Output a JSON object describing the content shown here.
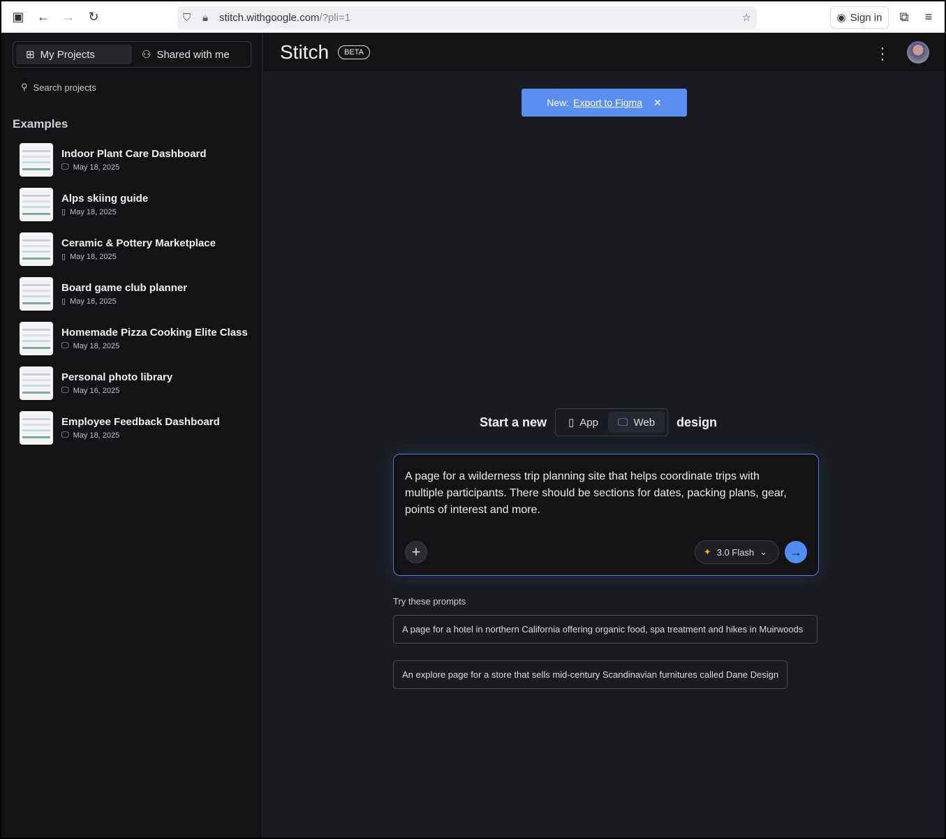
{
  "browser": {
    "url_host": "stitch.withgoogle.com",
    "url_query": "/?pli=1",
    "sign_in": "Sign in"
  },
  "sidebar": {
    "tabs": [
      {
        "label": "My Projects"
      },
      {
        "label": "Shared with me"
      }
    ],
    "search_placeholder": "Search projects",
    "section_title": "Examples",
    "items": [
      {
        "title": "Indoor Plant Care Dashboard",
        "date": "May 18, 2025",
        "type": "web"
      },
      {
        "title": "Alps skiing guide",
        "date": "May 18, 2025",
        "type": "app"
      },
      {
        "title": "Ceramic & Pottery Marketplace",
        "date": "May 18, 2025",
        "type": "app"
      },
      {
        "title": "Board game club planner",
        "date": "May 16, 2025",
        "type": "app"
      },
      {
        "title": "Homemade Pizza Cooking Elite Class",
        "date": "May 18, 2025",
        "type": "web"
      },
      {
        "title": "Personal photo library",
        "date": "May 16, 2025",
        "type": "web"
      },
      {
        "title": "Employee Feedback Dashboard",
        "date": "May 18, 2025",
        "type": "web"
      }
    ]
  },
  "header": {
    "logo": "Stitch",
    "badge": "BETA"
  },
  "banner": {
    "prefix": "New:",
    "link": "Export to Figma"
  },
  "start": {
    "before": "Start a new",
    "app": "App",
    "web": "Web",
    "after": "design",
    "selected": "Web"
  },
  "prompt": {
    "text": "A page for a wilderness trip planning site that helps coordinate trips with multiple participants.  There should be sections for dates, packing plans, gear, points of interest and more.",
    "model": "3.0 Flash"
  },
  "suggestions": {
    "title": "Try these prompts",
    "items": [
      "A page for a hotel in northern California offering organic food, spa treatment and hikes in Muirwoods",
      "An explore page for a store that sells mid-century Scandinavian furnitures called Dane Design"
    ]
  }
}
